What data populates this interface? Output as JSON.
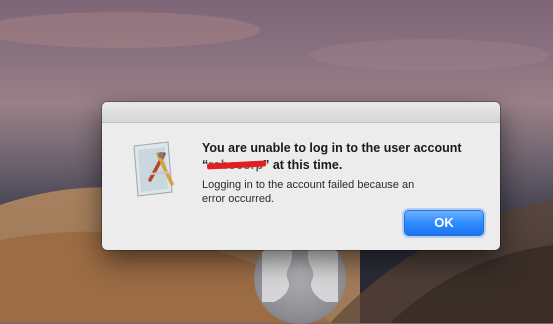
{
  "dialog": {
    "title_line1": "You are unable to log in to the user account",
    "title_quote_open": "“",
    "redacted_name": "robocorp",
    "title_line2_rest": "” at this time.",
    "message": "Logging in to the account failed because an error occurred.",
    "ok_label": "OK"
  },
  "icons": {
    "app": "directory-utility-icon",
    "avatar": "user-avatar-icon"
  },
  "colors": {
    "accent": "#2f8bff",
    "redaction": "#e02020",
    "dialog_bg": "#ececec"
  }
}
